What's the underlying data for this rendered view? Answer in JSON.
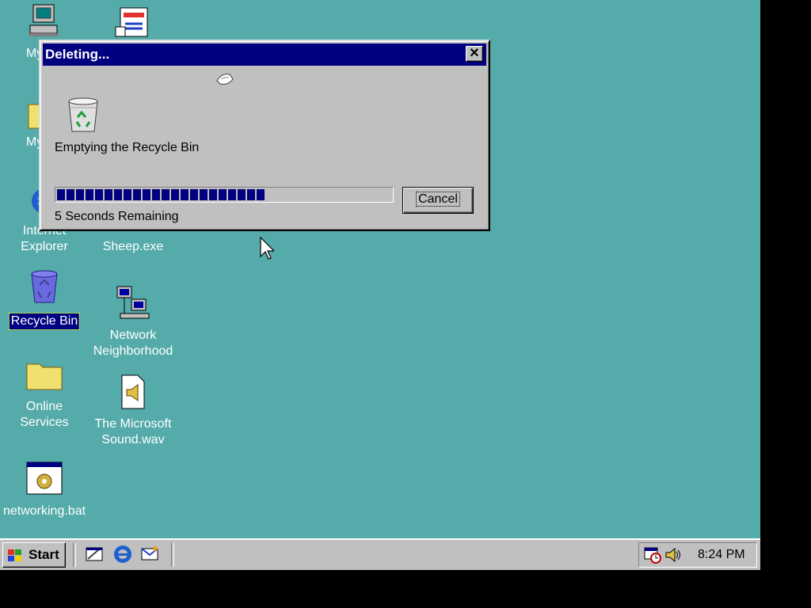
{
  "desktop": {
    "icons": [
      {
        "label": "My Co",
        "icon": "my-computer-icon"
      },
      {
        "label": "My Do",
        "icon": "my-documents-icon"
      },
      {
        "label": "Internet\nExplorer",
        "icon": "internet-explorer-icon"
      },
      {
        "label": "Recycle Bin",
        "icon": "recycle-bin-icon",
        "selected": true
      },
      {
        "label": "Online\nServices",
        "icon": "folder-icon"
      },
      {
        "label": "networking.bat",
        "icon": "batch-file-icon"
      },
      {
        "label": "",
        "icon": "inbox-icon"
      },
      {
        "label": "Sheep.exe",
        "icon": "sheep-icon"
      },
      {
        "label": "Network\nNeighborhood",
        "icon": "network-neighborhood-icon"
      },
      {
        "label": "The Microsoft\nSound.wav",
        "icon": "sound-file-icon"
      }
    ]
  },
  "dialog": {
    "title": "Deleting...",
    "close_label": "✕",
    "message": "Emptying the Recycle Bin",
    "remaining": "5 Seconds Remaining",
    "cancel_label": "Cancel",
    "progress": 0.62,
    "icon": "recycle-bin-icon"
  },
  "taskbar": {
    "start_label": "Start",
    "quick_launch": [
      "show-desktop-icon",
      "internet-explorer-icon",
      "outlook-express-icon"
    ],
    "tray_icons": [
      "scheduler-icon",
      "volume-icon"
    ],
    "clock": "8:24 PM"
  },
  "colors": {
    "desktop": "#55aaaa",
    "titlebar": "#000080",
    "face": "#c0c0c0"
  }
}
